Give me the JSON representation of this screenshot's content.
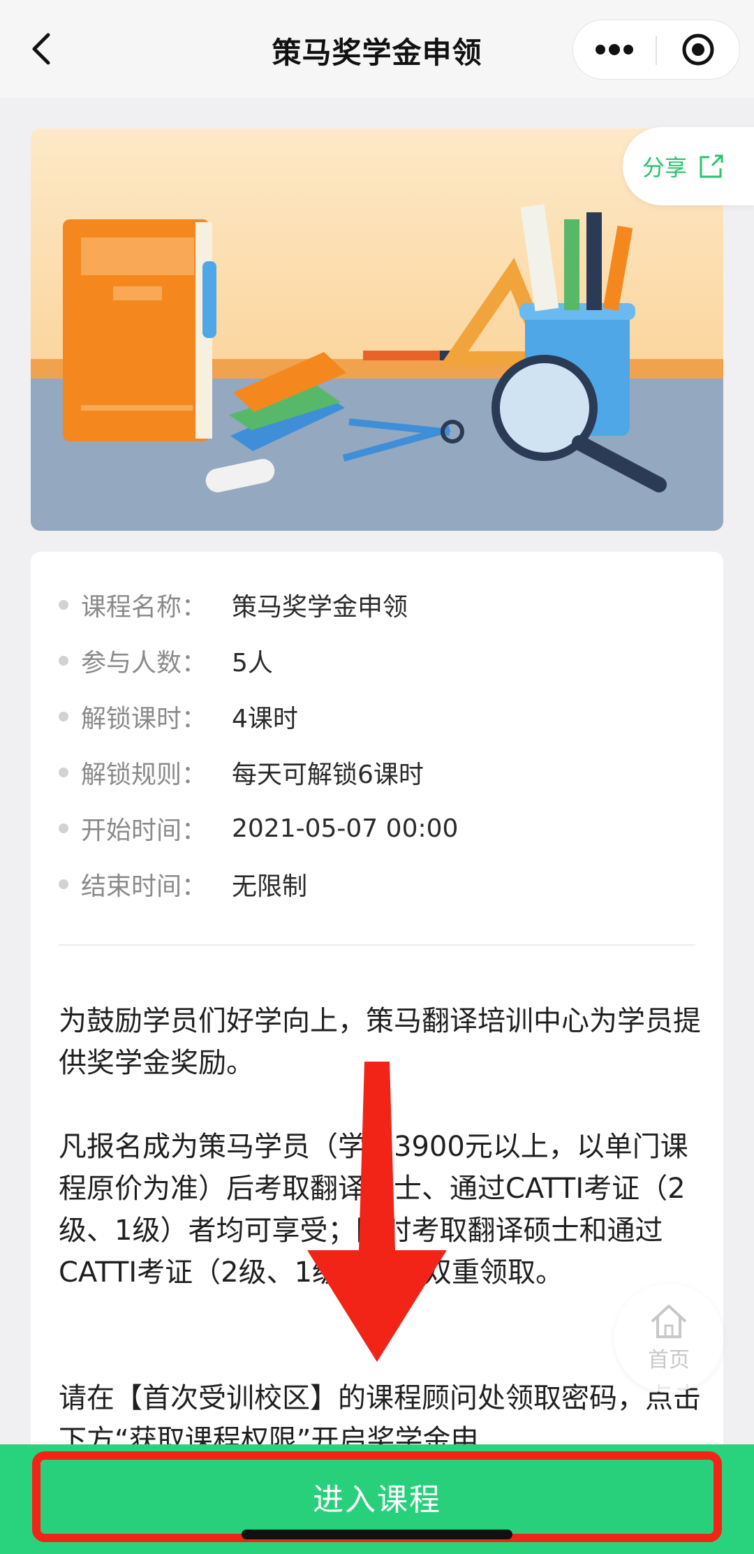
{
  "header": {
    "title": "策马奖学金申领"
  },
  "banner": {
    "share_label": "分享"
  },
  "course_info": [
    {
      "label": "课程名称：",
      "value": "策马奖学金申领"
    },
    {
      "label": "参与人数：",
      "value": "5人"
    },
    {
      "label": "解锁课时：",
      "value": "4课时"
    },
    {
      "label": "解锁规则：",
      "value": "每天可解锁6课时"
    },
    {
      "label": "开始时间：",
      "value": "2021-05-07 00:00"
    },
    {
      "label": "结束时间：",
      "value": "无限制"
    }
  ],
  "description": {
    "p1": "为鼓励学员们好学向上，策马翻译培训中心为学员提供奖学金奖励。",
    "p2": "凡报名成为策马学员（学费3900元以上，以单门课程原价为准）后考取翻译硕士、通过CATTI考证（2级、1级）者均可享受；同时考取翻译硕士和通过CATTI考证（2级、1级）者可双重领取。",
    "p3": "请在【首次受训校区】的课程顾问处领取密码，点击下方“获取课程权限”开启奖学金申"
  },
  "floating": {
    "home_label": "首页"
  },
  "footer": {
    "enter_label": "进入课程"
  },
  "colors": {
    "accent_green": "#29d37d",
    "highlight_red": "#f22417",
    "share_green": "#29c36a"
  }
}
